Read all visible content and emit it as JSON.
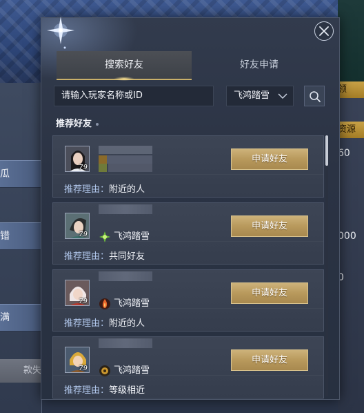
{
  "background": {
    "left_rows": [
      "瓜",
      "错",
      "满"
    ],
    "right_values": [
      "60",
      "000",
      "0"
    ],
    "right_tags": [
      "领",
      "资源"
    ],
    "left_button": "款失"
  },
  "tabs": {
    "search": "搜索好友",
    "requests": "好友申请"
  },
  "search": {
    "placeholder": "请输入玩家名称或ID",
    "server": "飞鸿踏雪"
  },
  "recommend": {
    "header": "推荐好友",
    "items": [
      {
        "level": "79",
        "server": "",
        "apply": "申请好友",
        "reason_label": "推荐理由：",
        "reason": "附近的人"
      },
      {
        "level": "79",
        "server": "飞鸿踏雪",
        "apply": "申请好友",
        "reason_label": "推荐理由：",
        "reason": "共同好友"
      },
      {
        "level": "79",
        "server": "飞鸿踏雪",
        "apply": "申请好友",
        "reason_label": "推荐理由：",
        "reason": "附近的人"
      },
      {
        "level": "79",
        "server": "飞鸿踏雪",
        "apply": "申请好友",
        "reason_label": "推荐理由：",
        "reason": "等级相近"
      }
    ]
  },
  "colors": {
    "accent_gold": "#c9b06a",
    "button_gold": "#b8995c",
    "reason_label": "#b3c9ee"
  },
  "icons": [
    "close-icon",
    "star-icon",
    "chevron-down-icon",
    "search-icon",
    "leaf-faction-icon",
    "flame-faction-icon",
    "beast-faction-icon"
  ]
}
